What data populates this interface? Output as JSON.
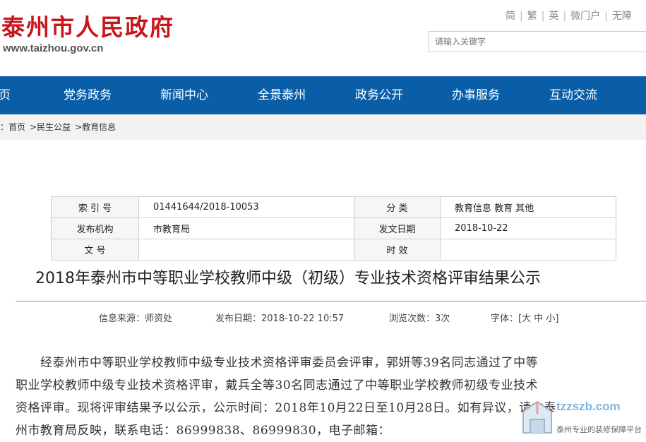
{
  "header": {
    "site_title": "泰州市人民政府",
    "site_url": "www.taizhou.gov.cn",
    "toplinks": [
      "简",
      "繁",
      "英",
      "微门户",
      "无障"
    ],
    "search_placeholder": "请输入关键字"
  },
  "nav": {
    "items": [
      "页",
      "党务政务",
      "新闻中心",
      "全景泰州",
      "政务公开",
      "办事服务",
      "互动交流"
    ]
  },
  "breadcrumb": {
    "prefix": "：",
    "items": [
      "首页",
      ">民生公益",
      ">教育信息"
    ]
  },
  "info_table": {
    "rows": [
      {
        "label1": "索 引 号",
        "value1": "01441644/2018-10053",
        "label2": "分  类",
        "value2": "教育信息 教育 其他"
      },
      {
        "label1": "发布机构",
        "value1": "市教育局",
        "label2": "发文日期",
        "value2": "2018-10-22"
      },
      {
        "label1": "文  号",
        "value1": "",
        "label2": "时  效",
        "value2": ""
      }
    ]
  },
  "article": {
    "title": "2018年泰州市中等职业学校教师中级（初级）专业技术资格评审结果公示",
    "meta": {
      "source": "信息来源：师资处",
      "date": "发布日期：2018-10-22 10:57",
      "views": "浏览次数：3次",
      "font": "字体：[大 中 小]"
    },
    "body_lines": [
      "　　经泰州市中等职业学校教师中级专业技术资格评审委员会评审，郭妍等39名同志通过了中等",
      "职业学校教师中级专业技术资格评审，戴兵全等30名同志通过了中等职业学校教师初级专业技术",
      "资格评审。现将评审结果予以公示，公示时间：2018年10月22日至10月28日。如有异议，请向泰",
      "州市教育局反映，联系电话：86999838、86999830，电子邮箱："
    ]
  },
  "watermark": {
    "site": "tzzszb.com",
    "slogan": "泰州专业的装修保障平台"
  }
}
